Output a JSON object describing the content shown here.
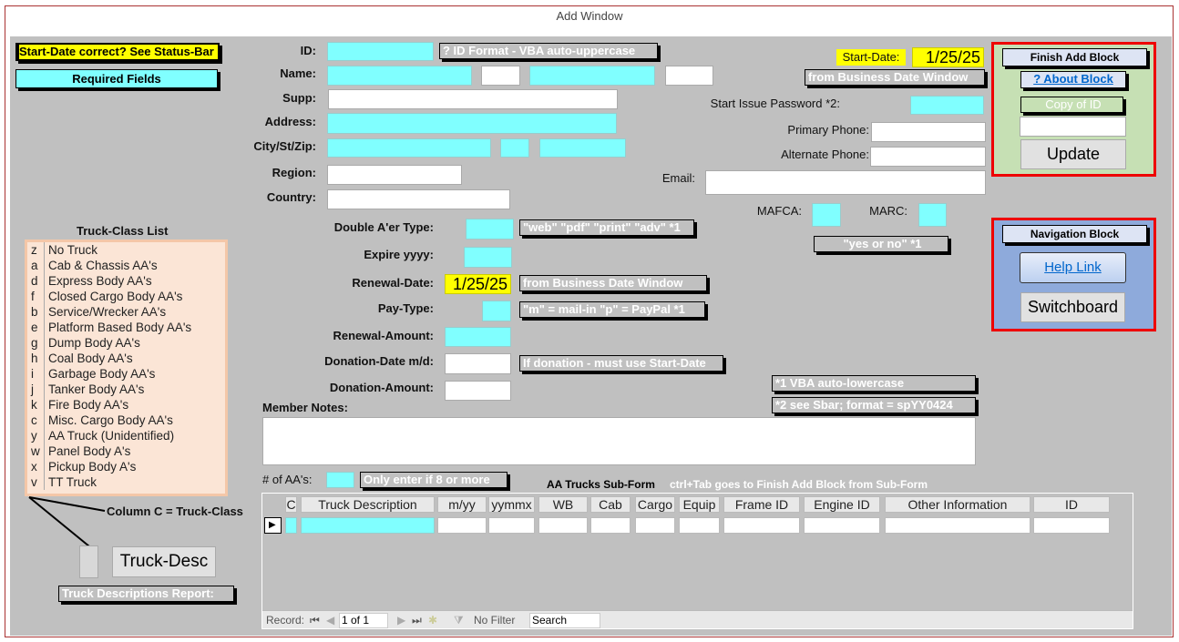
{
  "window": {
    "title": "Add Window"
  },
  "banners": {
    "start_date_check": "Start-Date correct? See Status-Bar",
    "required_fields": "Required Fields"
  },
  "fields": {
    "id": {
      "label": "ID:",
      "note": "? ID Format - VBA auto-uppercase"
    },
    "name": {
      "label": "Name:"
    },
    "supp": {
      "label": "Supp:"
    },
    "address": {
      "label": "Address:"
    },
    "city": {
      "label": "City/St/Zip:"
    },
    "region": {
      "label": "Region:"
    },
    "country": {
      "label": "Country:"
    },
    "start_date": {
      "label": "Start-Date:",
      "value": "1/25/25",
      "note": "from Business Date Window"
    },
    "password": {
      "label": "Start Issue Password *2:"
    },
    "primary_phone": {
      "label": "Primary Phone:"
    },
    "alternate_phone": {
      "label": "Alternate Phone:"
    },
    "email": {
      "label": "Email:"
    },
    "mafca": {
      "label": "MAFCA:"
    },
    "marc": {
      "label": "MARC:",
      "note": "\"yes or no\" *1"
    },
    "double_aer_type": {
      "label": "Double A'er Type:",
      "note": "\"web\" \"pdf\" \"print\" \"adv\" *1"
    },
    "expire": {
      "label": "Expire yyyy:"
    },
    "renewal_date": {
      "label": "Renewal-Date:",
      "value": "1/25/25",
      "note": "from Business Date Window"
    },
    "pay_type": {
      "label": "Pay-Type:",
      "note": "\"m\" = mail-in \"p\" = PayPal *1"
    },
    "renewal_amount": {
      "label": "Renewal-Amount:"
    },
    "donation_date": {
      "label": "Donation-Date m/d:",
      "note": "If donation - must use Start-Date"
    },
    "donation_amount": {
      "label": "Donation-Amount:"
    },
    "member_notes": {
      "label": "Member Notes:"
    },
    "num_aas": {
      "label": "# of AA's:",
      "note": "Only enter if 8 or more"
    }
  },
  "footnotes": {
    "n1": "*1 VBA auto-lowercase",
    "n2": "*2 see Sbar; format = spYY0424"
  },
  "finish_block": {
    "title": "Finish Add Block",
    "about": "? About Block",
    "copy_id": "Copy of ID",
    "update": "Update"
  },
  "nav_block": {
    "title": "Navigation Block",
    "help": "Help Link",
    "switchboard": "Switchboard"
  },
  "truck_list": {
    "title": "Truck-Class List",
    "items": [
      {
        "k": "z",
        "v": "No Truck"
      },
      {
        "k": "a",
        "v": "Cab & Chassis AA's"
      },
      {
        "k": "d",
        "v": "Express Body AA's"
      },
      {
        "k": "f",
        "v": "Closed Cargo Body AA's"
      },
      {
        "k": "b",
        "v": "Service/Wrecker AA's"
      },
      {
        "k": "e",
        "v": "Platform Based Body AA's"
      },
      {
        "k": "g",
        "v": "Dump Body AA's"
      },
      {
        "k": "h",
        "v": "Coal Body AA's"
      },
      {
        "k": "i",
        "v": "Garbage Body AA's"
      },
      {
        "k": "j",
        "v": "Tanker Body AA's"
      },
      {
        "k": "k",
        "v": "Fire Body AA's"
      },
      {
        "k": "c",
        "v": "Misc. Cargo Body AA's"
      },
      {
        "k": "y",
        "v": "AA Truck (Unidentified)"
      },
      {
        "k": "w",
        "v": "Panel Body A's"
      },
      {
        "k": "x",
        "v": "Pickup Body A's"
      },
      {
        "k": "v",
        "v": "TT Truck"
      }
    ],
    "column_note": "Column C = Truck-Class",
    "desc_button": "Truck-Desc",
    "report_note": "Truck Descriptions Report:"
  },
  "subform": {
    "title": "AA Trucks Sub-Form",
    "hint": "ctrl+Tab goes to Finish Add Block from Sub-Form",
    "columns": [
      "C",
      "Truck Description",
      "m/yy",
      "yymmx",
      "WB",
      "Cab",
      "Cargo",
      "Equip",
      "Frame ID",
      "Engine ID",
      "Other Information",
      "ID"
    ],
    "nav": {
      "record_label": "Record:",
      "position": "1 of 1",
      "filter": "No Filter",
      "search": "Search"
    }
  }
}
